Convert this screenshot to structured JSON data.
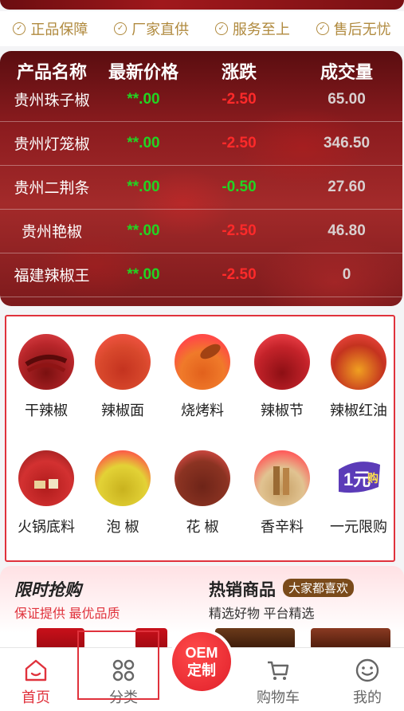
{
  "guarantees": [
    "正品保障",
    "厂家直供",
    "服务至上",
    "售后无忧"
  ],
  "market": {
    "headers": [
      "产品名称",
      "最新价格",
      "涨跌",
      "成交量"
    ],
    "rows": [
      {
        "name": "贵州珠子椒",
        "price": "**.00",
        "change": "-2.50",
        "volume": "65.00"
      },
      {
        "name": "贵州灯笼椒",
        "price": "**.00",
        "change": "-2.50",
        "volume": "346.50"
      },
      {
        "name": "贵州二荆条",
        "price": "**.00",
        "change": "-0.50",
        "volume": "27.60"
      },
      {
        "name": "贵州艳椒",
        "price": "**.00",
        "change": "-2.50",
        "volume": "46.80"
      },
      {
        "name": "福建辣椒王",
        "price": "**.00",
        "change": "-2.50",
        "volume": "0"
      }
    ],
    "colors": {
      "price": "#22d422",
      "change_red": "#ff2a2a",
      "change_green": "#22d422"
    }
  },
  "categories": [
    {
      "label": "干辣椒",
      "icon": "dried-chili-icon"
    },
    {
      "label": "辣椒面",
      "icon": "chili-powder-icon"
    },
    {
      "label": "烧烤料",
      "icon": "bbq-seasoning-icon"
    },
    {
      "label": "辣椒节",
      "icon": "chili-segment-icon"
    },
    {
      "label": "辣椒红油",
      "icon": "chili-oil-icon"
    },
    {
      "label": "火锅底料",
      "icon": "hotpot-base-icon"
    },
    {
      "label": "泡 椒",
      "icon": "pickled-pepper-icon"
    },
    {
      "label": "花 椒",
      "icon": "sichuan-pepper-icon"
    },
    {
      "label": "香辛料",
      "icon": "spices-icon"
    },
    {
      "label": "一元限购",
      "icon": "one-yuan-badge-icon"
    }
  ],
  "promo": {
    "flash_title": "限时抢购",
    "flash_sub": "保证提供 最优品质",
    "hot_title": "热销商品",
    "hot_badge": "大家都喜欢",
    "hot_sub": "精选好物 平台精选"
  },
  "oem": {
    "line1": "OEM",
    "line2": "定制"
  },
  "tabs": [
    {
      "label": "首页",
      "icon": "home-icon",
      "active": true
    },
    {
      "label": "分类",
      "icon": "category-grid-icon",
      "active": false
    },
    {
      "label": "购物车",
      "icon": "cart-icon",
      "active": false
    },
    {
      "label": "我的",
      "icon": "smile-profile-icon",
      "active": false
    }
  ],
  "accent": "#e0323c",
  "gold": "#b08a3e",
  "one_yuan_badge": {
    "main": "1元",
    "sub": "购"
  }
}
